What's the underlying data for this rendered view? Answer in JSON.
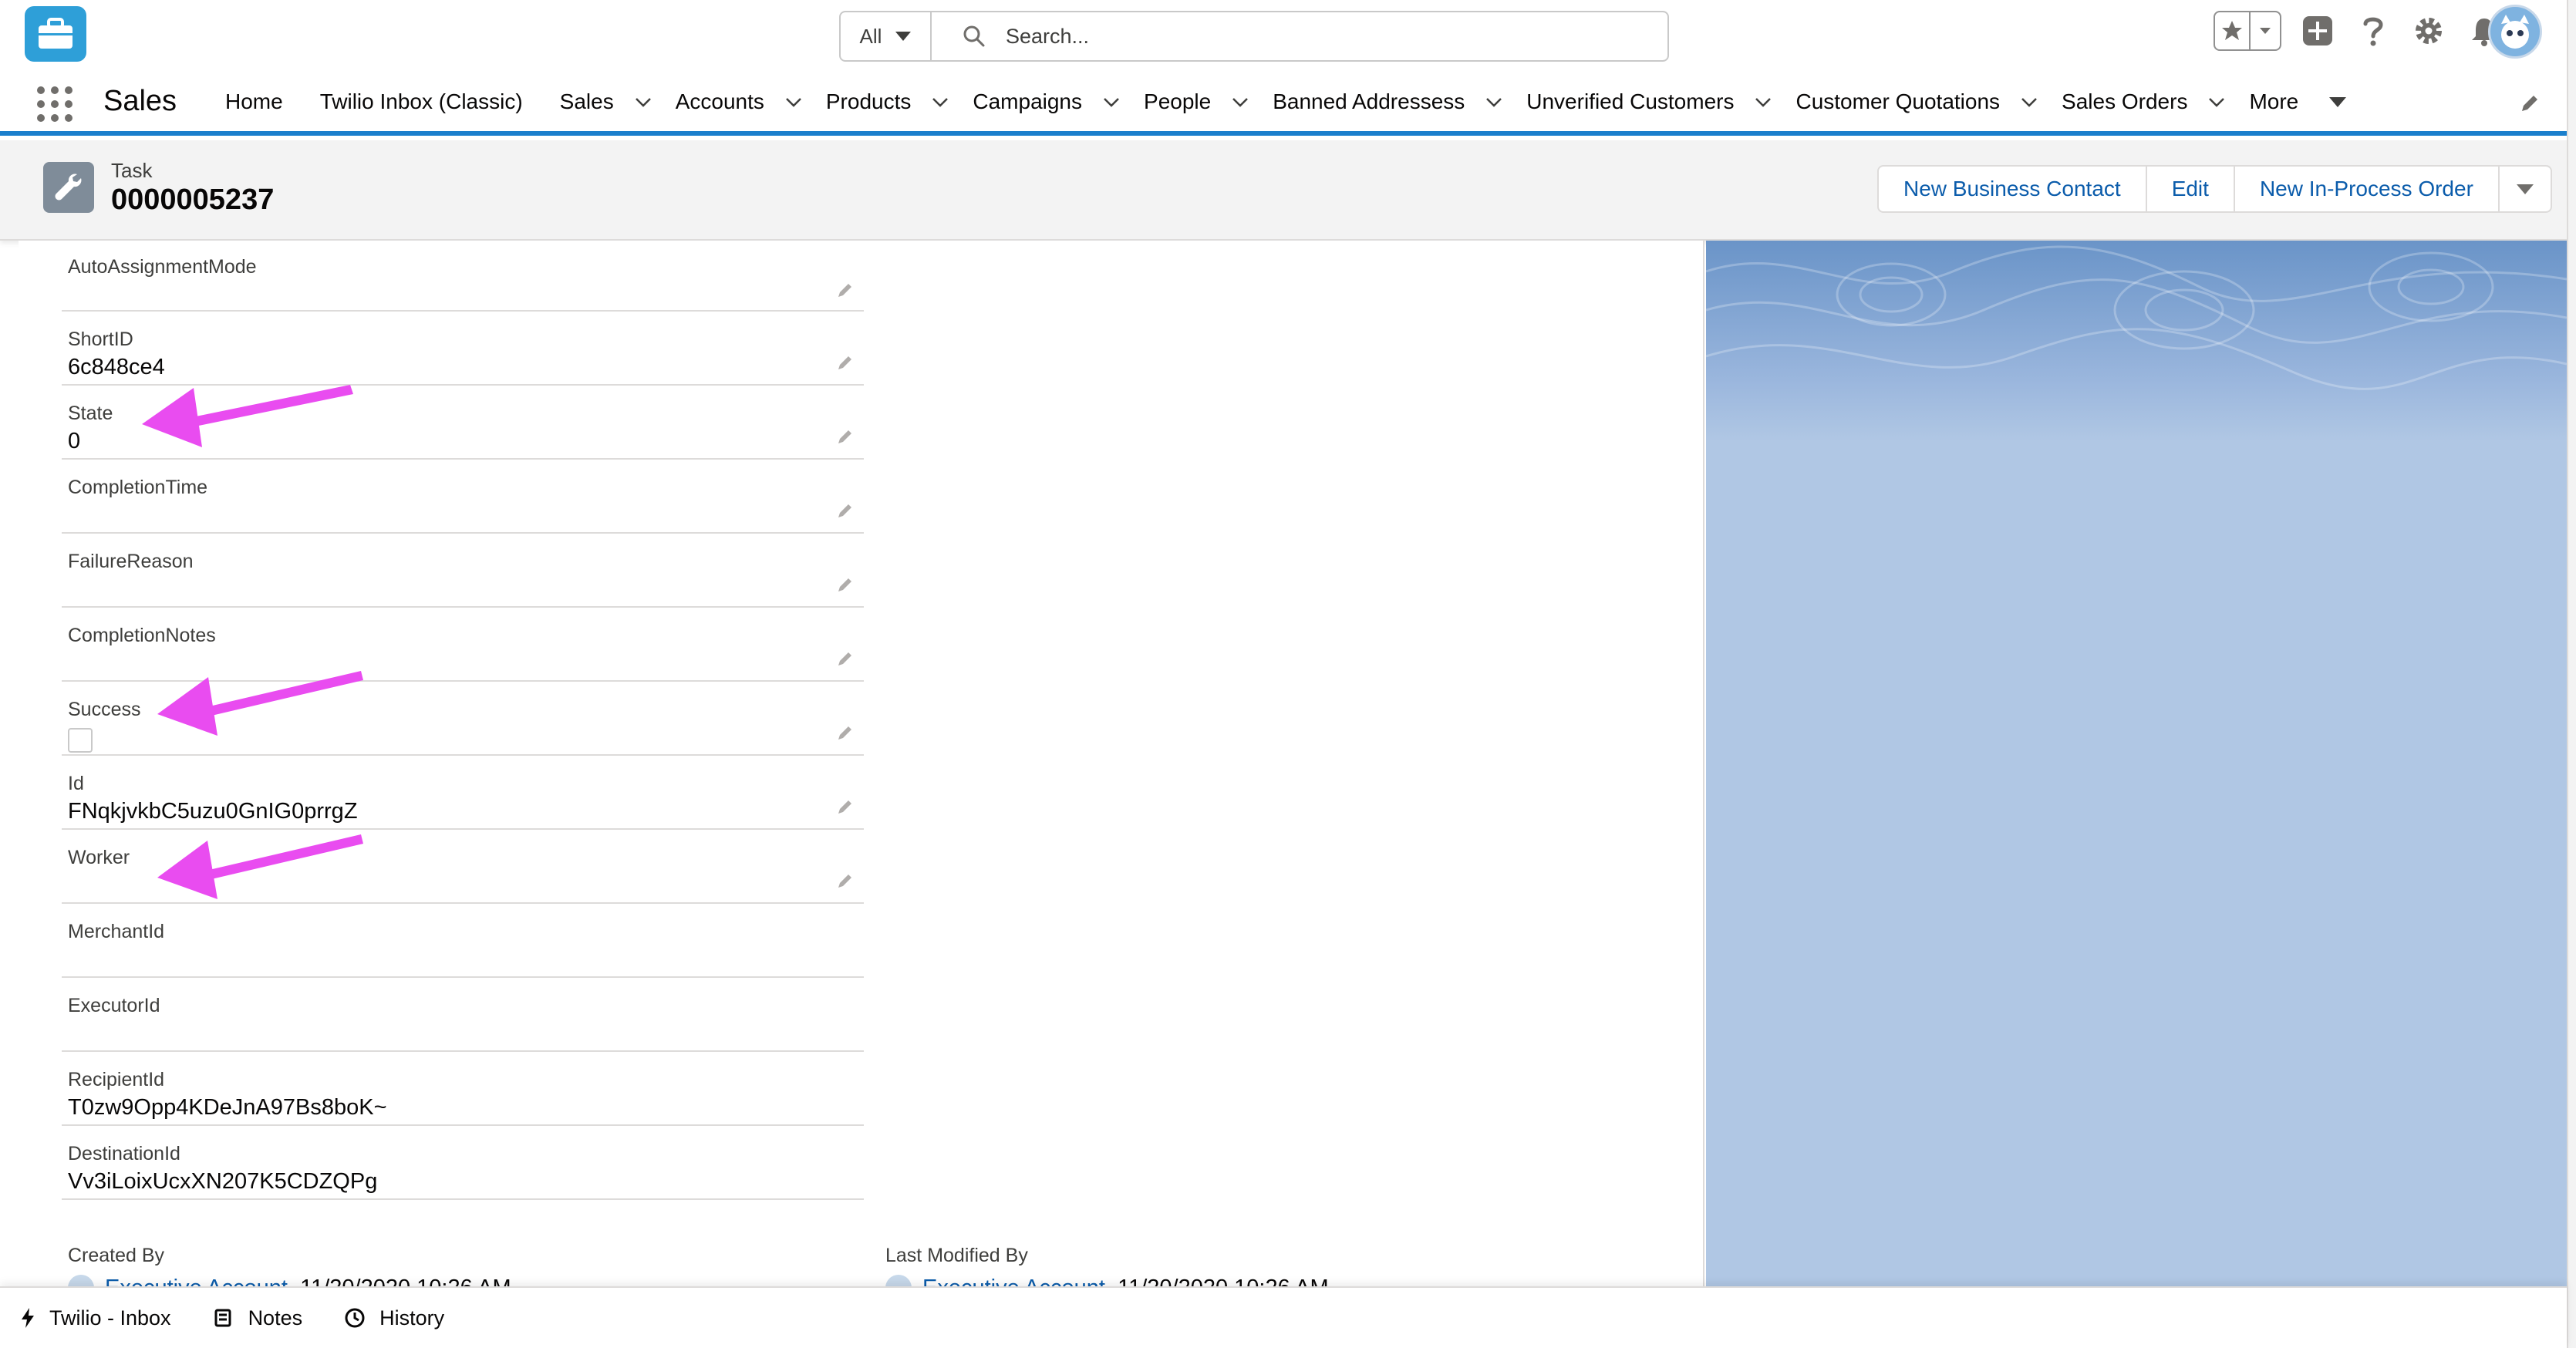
{
  "header": {
    "search_scope": "All",
    "search_placeholder": "Search..."
  },
  "nav": {
    "app_name": "Sales",
    "items": [
      {
        "label": "Home",
        "has_menu": false
      },
      {
        "label": "Twilio Inbox (Classic)",
        "has_menu": false
      },
      {
        "label": "Sales",
        "has_menu": true
      },
      {
        "label": "Accounts",
        "has_menu": true
      },
      {
        "label": "Products",
        "has_menu": true
      },
      {
        "label": "Campaigns",
        "has_menu": true
      },
      {
        "label": "People",
        "has_menu": true
      },
      {
        "label": "Banned Addressess",
        "has_menu": true
      },
      {
        "label": "Unverified Customers",
        "has_menu": true
      },
      {
        "label": "Customer Quotations",
        "has_menu": true
      },
      {
        "label": "Sales Orders",
        "has_menu": true
      }
    ],
    "more_label": "More"
  },
  "record": {
    "type": "Task",
    "name": "0000005237",
    "actions": [
      "New Business Contact",
      "Edit",
      "New In-Process Order"
    ]
  },
  "fields": [
    {
      "label": "AutoAssignmentMode",
      "value": "",
      "editable": true
    },
    {
      "label": "ShortID",
      "value": "6c848ce4",
      "editable": true
    },
    {
      "label": "State",
      "value": "0",
      "editable": true
    },
    {
      "label": "CompletionTime",
      "value": "",
      "editable": true
    },
    {
      "label": "FailureReason",
      "value": "",
      "editable": true
    },
    {
      "label": "CompletionNotes",
      "value": "",
      "editable": true
    },
    {
      "label": "Success",
      "value": "",
      "editable": true,
      "checkbox": true,
      "checked": false
    },
    {
      "label": "Id",
      "value": "FNqkjvkbC5uzu0GnIG0prrgZ",
      "editable": true
    },
    {
      "label": "Worker",
      "value": "",
      "editable": true
    },
    {
      "label": "MerchantId",
      "value": "",
      "editable": false
    },
    {
      "label": "ExecutorId",
      "value": "",
      "editable": false
    },
    {
      "label": "RecipientId",
      "value": "T0zw9Opp4KDeJnA97Bs8boK~",
      "editable": false
    },
    {
      "label": "DestinationId",
      "value": "Vv3iLoixUcxXN207K5CDZQPg",
      "editable": false
    }
  ],
  "system_info": {
    "created_by_label": "Created By",
    "created_by_user": "Executive Account",
    "created_date": ", 11/20/2020 10:26 AM",
    "modified_by_label": "Last Modified By",
    "modified_by_user": "Executive Account",
    "modified_date": ", 11/20/2020 10:26 AM"
  },
  "utility_bar": {
    "items": [
      "Twilio - Inbox",
      "Notes",
      "History"
    ]
  },
  "colors": {
    "brand_blue": "#1b7fcc",
    "link_blue": "#0b5cab",
    "annotation_arrow": "#e94cf0"
  }
}
